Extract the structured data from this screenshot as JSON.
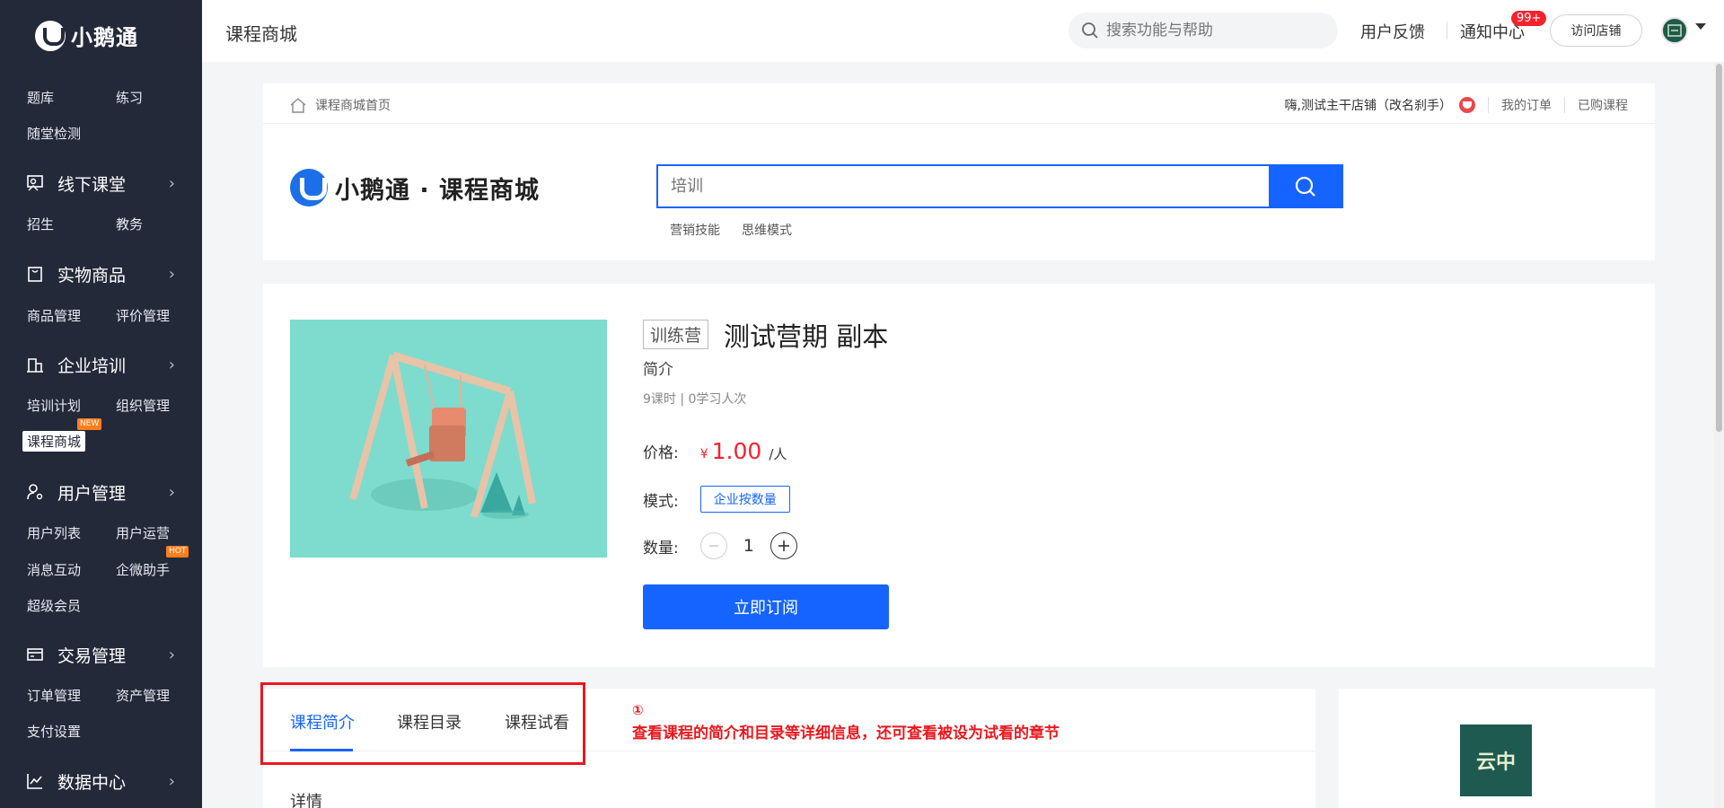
{
  "sidebar": {
    "logo_text": "小鹅通",
    "items": [
      {
        "label": "题库"
      },
      {
        "label": "练习"
      },
      {
        "label": "随堂检测"
      },
      {
        "label": "招生"
      },
      {
        "label": "教务"
      },
      {
        "label": "商品管理"
      },
      {
        "label": "评价管理"
      },
      {
        "label": "培训计划"
      },
      {
        "label": "组织管理"
      },
      {
        "label": "课程商城"
      },
      {
        "label": "用户列表"
      },
      {
        "label": "用户运营"
      },
      {
        "label": "消息互动"
      },
      {
        "label": "企微助手"
      },
      {
        "label": "超级会员"
      },
      {
        "label": "订单管理"
      },
      {
        "label": "资产管理"
      },
      {
        "label": "支付设置"
      }
    ],
    "groups": [
      {
        "label": "线下课堂",
        "icon": "classroom-icon"
      },
      {
        "label": "实物商品",
        "icon": "bag-icon"
      },
      {
        "label": "企业培训",
        "icon": "building-icon"
      },
      {
        "label": "用户管理",
        "icon": "user-settings-icon"
      },
      {
        "label": "交易管理",
        "icon": "card-icon"
      },
      {
        "label": "数据中心",
        "icon": "chart-icon"
      }
    ],
    "badges": {
      "new": "NEW",
      "hot": "HOT"
    }
  },
  "topbar": {
    "title": "课程商城",
    "search_placeholder": "搜索功能与帮助",
    "feedback": "用户反馈",
    "notifications": "通知中心",
    "notif_count": "99+",
    "visit_store": "访问店铺"
  },
  "store": {
    "home_link": "课程商城首页",
    "greeting": "嗨,测试主干店铺（改名刹手）",
    "my_orders": "我的订单",
    "purchased": "已购课程",
    "logo_text": "小鹅通 · 课程商城",
    "search_value": "培训",
    "hot_tags": [
      "营销技能",
      "思维模式"
    ]
  },
  "product": {
    "tag": "训练营",
    "title": "测试营期 副本",
    "subtitle": "简介",
    "meta": "9课时 | 0学习人次",
    "price_label": "价格:",
    "price_symbol": "¥",
    "price": "1.00",
    "price_unit": "/人",
    "mode_label": "模式:",
    "mode": "企业按数量",
    "qty_label": "数量:",
    "qty": "1",
    "subscribe": "立即订阅"
  },
  "tabs": {
    "items": [
      "课程简介",
      "课程目录",
      "课程试看"
    ],
    "active_index": 0,
    "detail_label": "详情"
  },
  "annotation": {
    "number": "①",
    "text": "查看课程的简介和目录等详细信息，还可查看被设为试看的章节"
  },
  "shop_card": {
    "avatar_text": "云中"
  },
  "colors": {
    "sidebar_bg": "#24293a",
    "accent": "#1664ff",
    "price": "#f5222d",
    "annotation": "#e8191e",
    "cover_bg": "#7ddccd"
  }
}
